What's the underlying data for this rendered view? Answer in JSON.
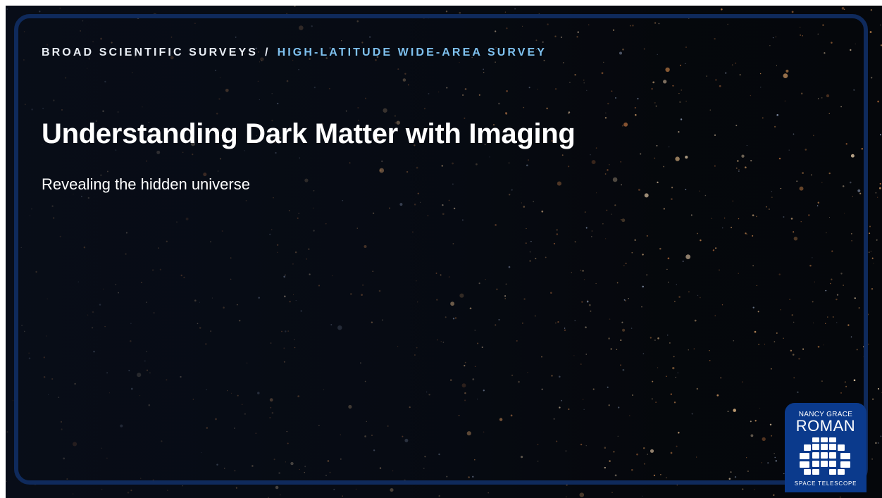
{
  "breadcrumb": {
    "parent": "BROAD SCIENTIFIC SURVEYS",
    "separator": "/",
    "current": "HIGH-LATITUDE WIDE-AREA SURVEY"
  },
  "hero": {
    "title": "Understanding Dark Matter with Imaging",
    "subtitle": "Revealing the hidden universe"
  },
  "logo": {
    "top_line": "NANCY GRACE",
    "name": "ROMAN",
    "bottom_line": "SPACE TELESCOPE",
    "icon": "detector-grid-icon"
  },
  "colors": {
    "background": "#05070b",
    "frame": "#0f2a5c",
    "breadcrumb_current": "#7fc2f0",
    "logo_background": "#0b3a8c",
    "star_warm": "#e0a060"
  }
}
